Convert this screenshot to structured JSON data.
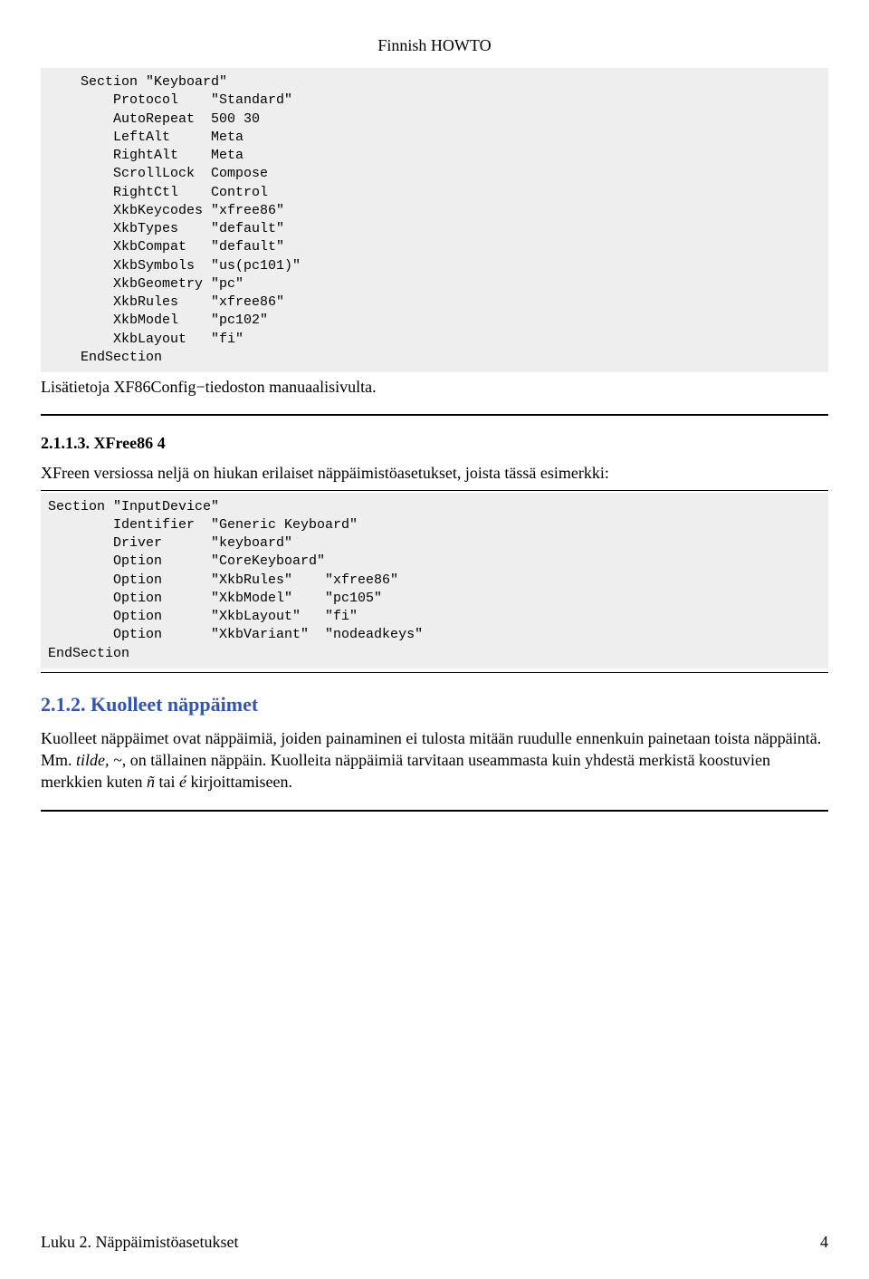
{
  "header": {
    "title": "Finnish HOWTO"
  },
  "code1": "    Section \"Keyboard\"\n        Protocol    \"Standard\"\n        AutoRepeat  500 30\n        LeftAlt     Meta\n        RightAlt    Meta\n        ScrollLock  Compose\n        RightCtl    Control\n        XkbKeycodes \"xfree86\"\n        XkbTypes    \"default\"\n        XkbCompat   \"default\"\n        XkbSymbols  \"us(pc101)\"\n        XkbGeometry \"pc\"\n        XkbRules    \"xfree86\"\n        XkbModel    \"pc102\"\n        XkbLayout   \"fi\"\n    EndSection",
  "para1": "Lisätietoja XF86Config−tiedoston manuaalisivulta.",
  "sub1": "2.1.1.3. XFree86 4",
  "para2": "XFreen versiossa neljä on hiukan erilaiset näppäimistöasetukset, joista tässä esimerkki:",
  "code2": "Section \"InputDevice\"\n        Identifier  \"Generic Keyboard\"\n        Driver      \"keyboard\"\n        Option      \"CoreKeyboard\"\n        Option      \"XkbRules\"    \"xfree86\"\n        Option      \"XkbModel\"    \"pc105\"\n        Option      \"XkbLayout\"   \"fi\"\n        Option      \"XkbVariant\"  \"nodeadkeys\"\nEndSection",
  "h2": "2.1.2. Kuolleet näppäimet",
  "para3_a": "Kuolleet näppäimet ovat näppäimiä, joiden painaminen ei tulosta mitään ruudulle ennenkuin painetaan toista näppäintä. Mm. ",
  "para3_i": "tilde, ~",
  "para3_b": ", on tällainen näppäin. Kuolleita näppäimiä tarvitaan useammasta kuin yhdestä merkistä koostuvien merkkien kuten ",
  "para3_n": "ñ",
  "para3_c": " tai ",
  "para3_e": "é",
  "para3_d": " kirjoittamiseen.",
  "footer": {
    "left": "Luku 2. Näppäimistöasetukset",
    "right": "4"
  }
}
